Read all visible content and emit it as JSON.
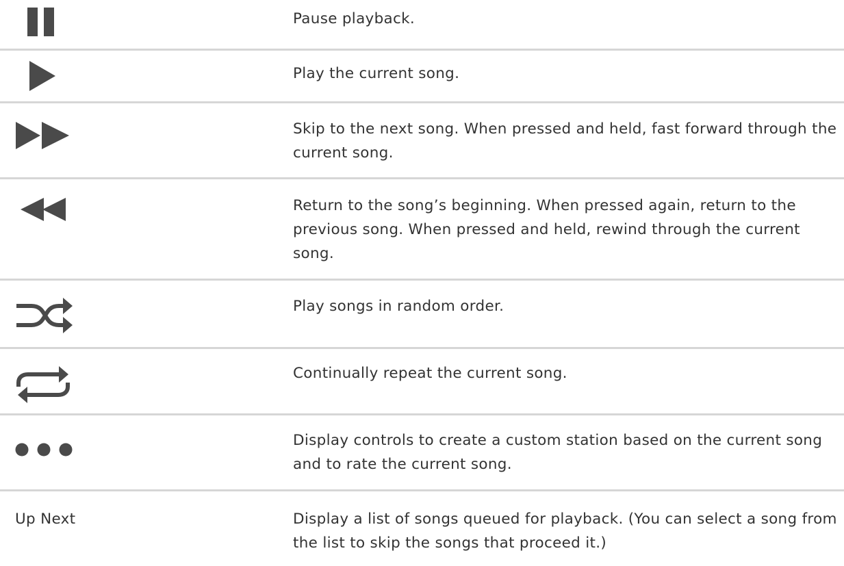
{
  "colors": {
    "icon": "#4a4a4a",
    "text": "#333333",
    "divider": "#d6d6d6"
  },
  "rows": [
    {
      "icon": "pause-icon",
      "description": "Pause playback."
    },
    {
      "icon": "play-icon",
      "description": "Play the current song."
    },
    {
      "icon": "fast-forward-icon",
      "description": "Skip to the next song. When pressed and held, fast forward through the current song."
    },
    {
      "icon": "rewind-icon",
      "description": "Return to the song’s beginning. When pressed again, return to the previous song. When pressed and held, rewind through the current song."
    },
    {
      "icon": "shuffle-icon",
      "description": "Play songs in random order."
    },
    {
      "icon": "repeat-icon",
      "description": "Continually repeat the current song."
    },
    {
      "icon": "more-icon",
      "description": "Display controls to create a custom station based on the current song and to rate the current song."
    },
    {
      "label": "Up Next",
      "description": "Display a list of songs queued for playback. (You can select a song from the list to skip the songs that proceed it.)"
    }
  ]
}
